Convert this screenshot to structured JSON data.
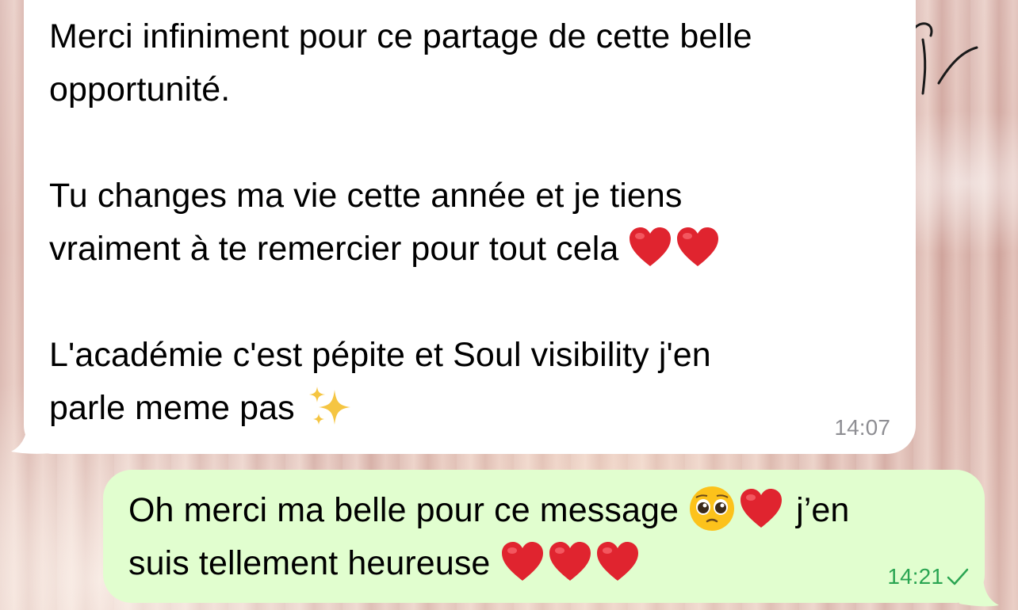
{
  "conversation": {
    "incoming_message": {
      "paragraphs": [
        {
          "lines": [
            "Merci infiniment pour ce partage de cette belle",
            "opportunité."
          ]
        },
        {
          "line1": "Tu changes ma vie cette année et je tiens",
          "line2": "vraiment à te remercier pour tout cela",
          "emojis": [
            "red-heart",
            "red-heart"
          ]
        },
        {
          "line1": "L'académie c'est pépite et Soul visibility j'en",
          "line2": "parle meme pas",
          "emojis": [
            "sparkles"
          ]
        }
      ],
      "time": "14:07"
    },
    "outgoing_message": {
      "line1_text": "Oh merci ma belle pour ce message",
      "line1_emojis": [
        "pleading-face",
        "red-heart"
      ],
      "line1_tail": "j’en",
      "line2_text": "suis tellement heureuse",
      "line2_emojis": [
        "red-heart",
        "red-heart",
        "red-heart"
      ],
      "time": "14:21",
      "status_icon": "single-check-icon"
    }
  },
  "colors": {
    "incoming_bubble": "#ffffff",
    "outgoing_bubble": "#e1fecf",
    "incoming_time": "#8e8e93",
    "outgoing_time": "#2aa552",
    "heart": "#e0242f"
  }
}
